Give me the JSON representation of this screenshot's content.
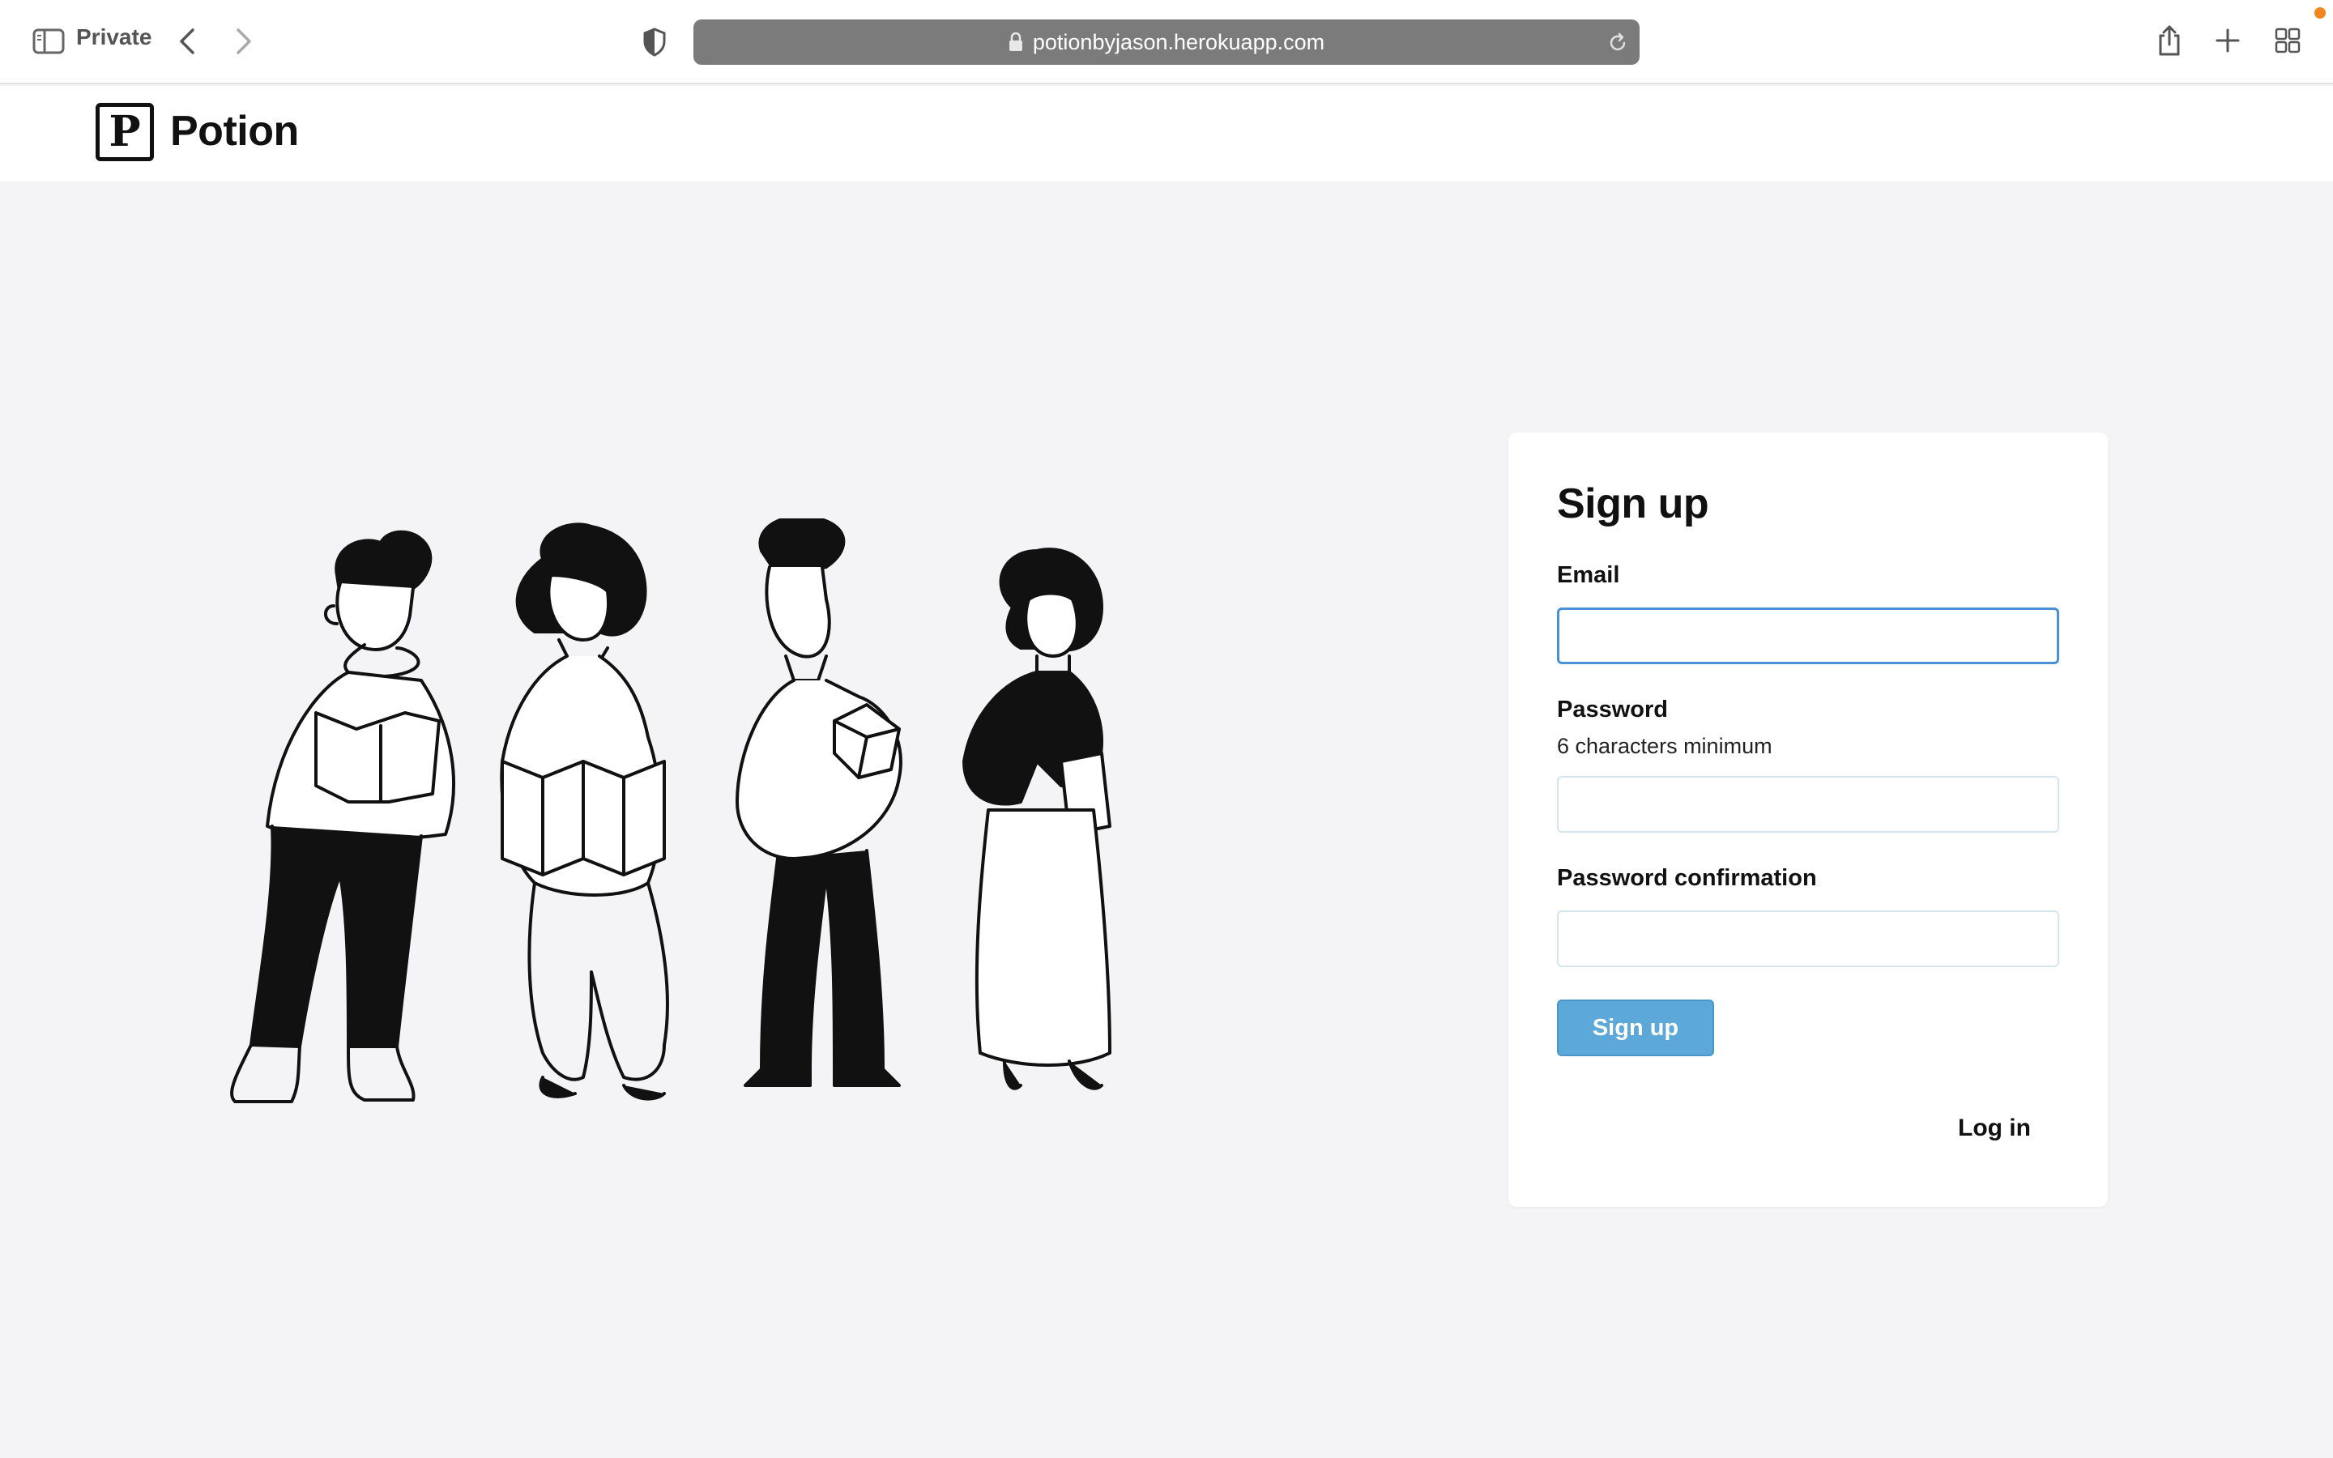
{
  "browser": {
    "private_label": "Private",
    "url": "potionbyjason.herokuapp.com"
  },
  "site": {
    "logo_letter": "P",
    "name": "Potion"
  },
  "illustration": {
    "description_icon": "people-reading-illustration"
  },
  "signup": {
    "title": "Sign up",
    "email_label": "Email",
    "email_value": "",
    "password_label": "Password",
    "password_hint": "6 characters minimum",
    "password_value": "",
    "confirmation_label": "Password confirmation",
    "confirmation_value": "",
    "submit_label": "Sign up",
    "login_link": "Log in"
  },
  "colors": {
    "page_bg": "#f4f4f6",
    "button_bg": "#5ba8d9",
    "focus_border": "#4a90d9",
    "address_bar": "#7b7b7b",
    "notification": "#f5861f"
  }
}
